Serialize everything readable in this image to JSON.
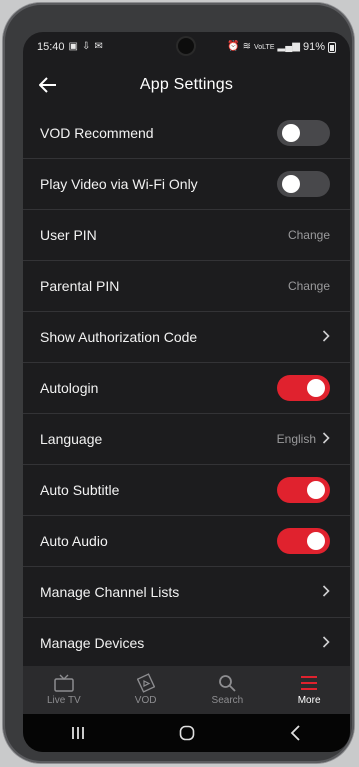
{
  "status_bar": {
    "time": "15:40",
    "battery": "91%",
    "network": "VoLTE"
  },
  "header": {
    "title": "App Settings"
  },
  "settings": [
    {
      "label": "VOD Recommend",
      "type": "toggle",
      "on": false
    },
    {
      "label": "Play Video via Wi-Fi Only",
      "type": "toggle",
      "on": false
    },
    {
      "label": "User PIN",
      "type": "action",
      "value": "Change"
    },
    {
      "label": "Parental PIN",
      "type": "action",
      "value": "Change"
    },
    {
      "label": "Show Authorization Code",
      "type": "link",
      "value": ""
    },
    {
      "label": "Autologin",
      "type": "toggle",
      "on": true
    },
    {
      "label": "Language",
      "type": "link",
      "value": "English"
    },
    {
      "label": "Auto Subtitle",
      "type": "toggle",
      "on": true
    },
    {
      "label": "Auto Audio",
      "type": "toggle",
      "on": true
    },
    {
      "label": "Manage Channel Lists",
      "type": "link",
      "value": ""
    },
    {
      "label": "Manage Devices",
      "type": "link",
      "value": ""
    }
  ],
  "bottom_nav": {
    "items": [
      {
        "label": "Live TV",
        "icon": "tv-icon",
        "active": false
      },
      {
        "label": "VOD",
        "icon": "vod-icon",
        "active": false
      },
      {
        "label": "Search",
        "icon": "search-icon",
        "active": false
      },
      {
        "label": "More",
        "icon": "menu-icon",
        "active": true
      }
    ]
  },
  "colors": {
    "accent": "#e0222e",
    "background": "#1c1c1e",
    "nav_background": "#2b2b2d"
  }
}
